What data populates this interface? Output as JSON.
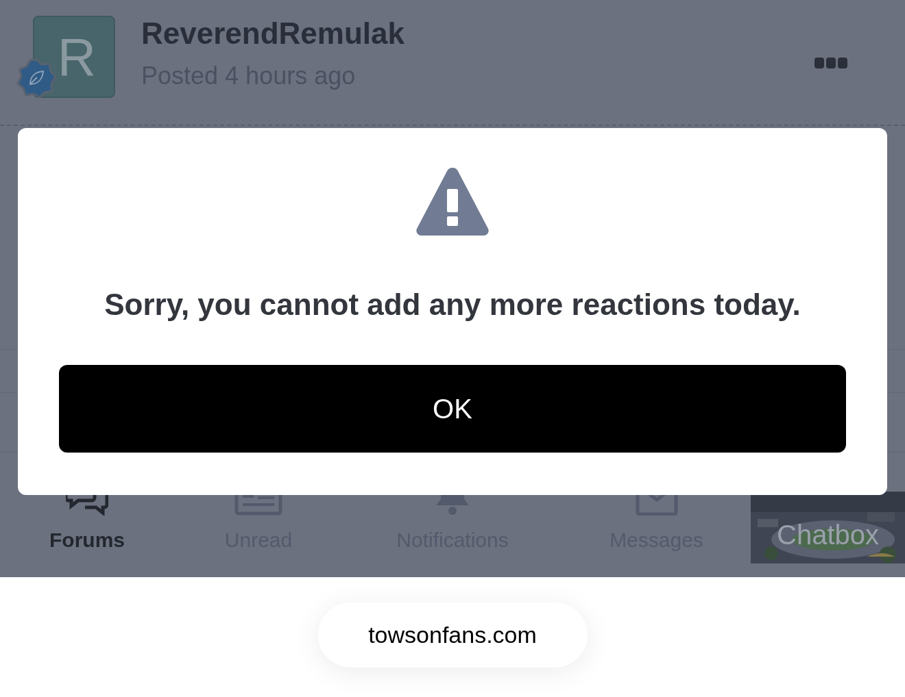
{
  "post": {
    "author": "ReverendRemulak",
    "avatar_letter": "R",
    "time": "Posted 4 hours ago"
  },
  "dialog": {
    "message": "Sorry, you cannot add any more reactions today.",
    "button": "OK"
  },
  "tabs": [
    {
      "label": "Forums",
      "selected": true,
      "kind": "forums"
    },
    {
      "label": "Unread",
      "selected": false,
      "kind": "unread"
    },
    {
      "label": "Notifications",
      "selected": false,
      "kind": "notifications"
    },
    {
      "label": "Messages",
      "selected": false,
      "kind": "messages"
    }
  ],
  "chatbox": {
    "label": "Chatbox"
  },
  "address_bar": {
    "url": "towsonfans.com"
  }
}
